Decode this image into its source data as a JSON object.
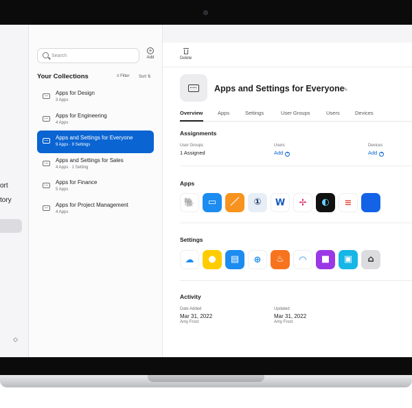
{
  "sidebar": {
    "cut_label_1": "ort",
    "cut_label_2": "tory",
    "stepper": "◇"
  },
  "collections": {
    "search_placeholder": "Search",
    "add_label": "Add",
    "title": "Your Collections",
    "filter_label": "≡ Filter",
    "sort_label": "Sort ⇅",
    "items": [
      {
        "title": "Apps for Design",
        "subtitle": "3 Apps"
      },
      {
        "title": "Apps for Engineering",
        "subtitle": "4 Apps"
      },
      {
        "title": "Apps and Settings for Everyone",
        "subtitle": "9 Apps · 9 Settings"
      },
      {
        "title": "Apps and Settings for Sales",
        "subtitle": "4 Apps · 1 Setting"
      },
      {
        "title": "Apps for Finance",
        "subtitle": "5 Apps"
      },
      {
        "title": "Apps for Project Management",
        "subtitle": "4 Apps"
      }
    ]
  },
  "detail": {
    "delete_label": "Delete",
    "title": "Apps and Settings for Everyone",
    "tabs": [
      "Overview",
      "Apps",
      "Settings",
      "User Groups",
      "Users",
      "Devices"
    ],
    "assignments": {
      "heading": "Assignments",
      "user_groups_label": "User Groups",
      "user_groups_value": "1 Assigned",
      "users_label": "Users",
      "users_action": "Add",
      "devices_label": "Devices",
      "devices_action": "Add"
    },
    "apps_heading": "Apps",
    "apps": [
      {
        "icon": "evernote-icon",
        "glyph": "🐘",
        "bg": "#ffffff",
        "fg": "#00a82d"
      },
      {
        "icon": "keynote-icon",
        "glyph": "▭",
        "bg": "#1c8cf0",
        "fg": "#ffffff"
      },
      {
        "icon": "pages-icon",
        "glyph": "／",
        "bg": "#f7931e",
        "fg": "#ffffff"
      },
      {
        "icon": "1password-icon",
        "glyph": "①",
        "bg": "#e8eef6",
        "fg": "#1a3a6a"
      },
      {
        "icon": "word-icon",
        "glyph": "W",
        "bg": "#ffffff",
        "fg": "#185abd"
      },
      {
        "icon": "slack-icon",
        "glyph": "✢",
        "bg": "#ffffff",
        "fg": "#e01e5a"
      },
      {
        "icon": "webex-icon",
        "glyph": "◐",
        "bg": "#111111",
        "fg": "#6ad0ff"
      },
      {
        "icon": "speaker-deck-icon",
        "glyph": "≡",
        "bg": "#ffffff",
        "fg": "#e5533d"
      },
      {
        "icon": "apple-support-icon",
        "glyph": "",
        "bg": "#1463e6",
        "fg": "#ffffff"
      }
    ],
    "settings_heading": "Settings",
    "settings": [
      {
        "icon": "icloud-icon",
        "glyph": "☁",
        "bg": "#ffffff",
        "fg": "#1c8cf0"
      },
      {
        "icon": "tips-icon",
        "glyph": "●",
        "bg": "#ffcc00",
        "fg": "#ffffff"
      },
      {
        "icon": "printer-icon",
        "glyph": "▤",
        "bg": "#1c8cf0",
        "fg": "#ffffff"
      },
      {
        "icon": "network-globe-icon",
        "glyph": "⊕",
        "bg": "#ffffff",
        "fg": "#1c8cf0"
      },
      {
        "icon": "firewall-icon",
        "glyph": "♨",
        "bg": "#f7731e",
        "fg": "#ffffff"
      },
      {
        "icon": "wifi-icon",
        "glyph": "◠",
        "bg": "#ffffff",
        "fg": "#1c8cf0"
      },
      {
        "icon": "lock-icon",
        "glyph": "■",
        "bg": "#9b38e6",
        "fg": "#ffffff"
      },
      {
        "icon": "screen-lock-icon",
        "glyph": "▣",
        "bg": "#16b6e6",
        "fg": "#ffffff"
      },
      {
        "icon": "home-security-icon",
        "glyph": "⌂",
        "bg": "#dcdcdf",
        "fg": "#333333"
      }
    ],
    "activity": {
      "heading": "Activity",
      "added_label": "Date Added",
      "added_date": "Mar 31, 2022",
      "added_by": "Amy Frost",
      "updated_label": "Updated",
      "updated_date": "Mar 31, 2022",
      "updated_by": "Amy Frost"
    }
  }
}
